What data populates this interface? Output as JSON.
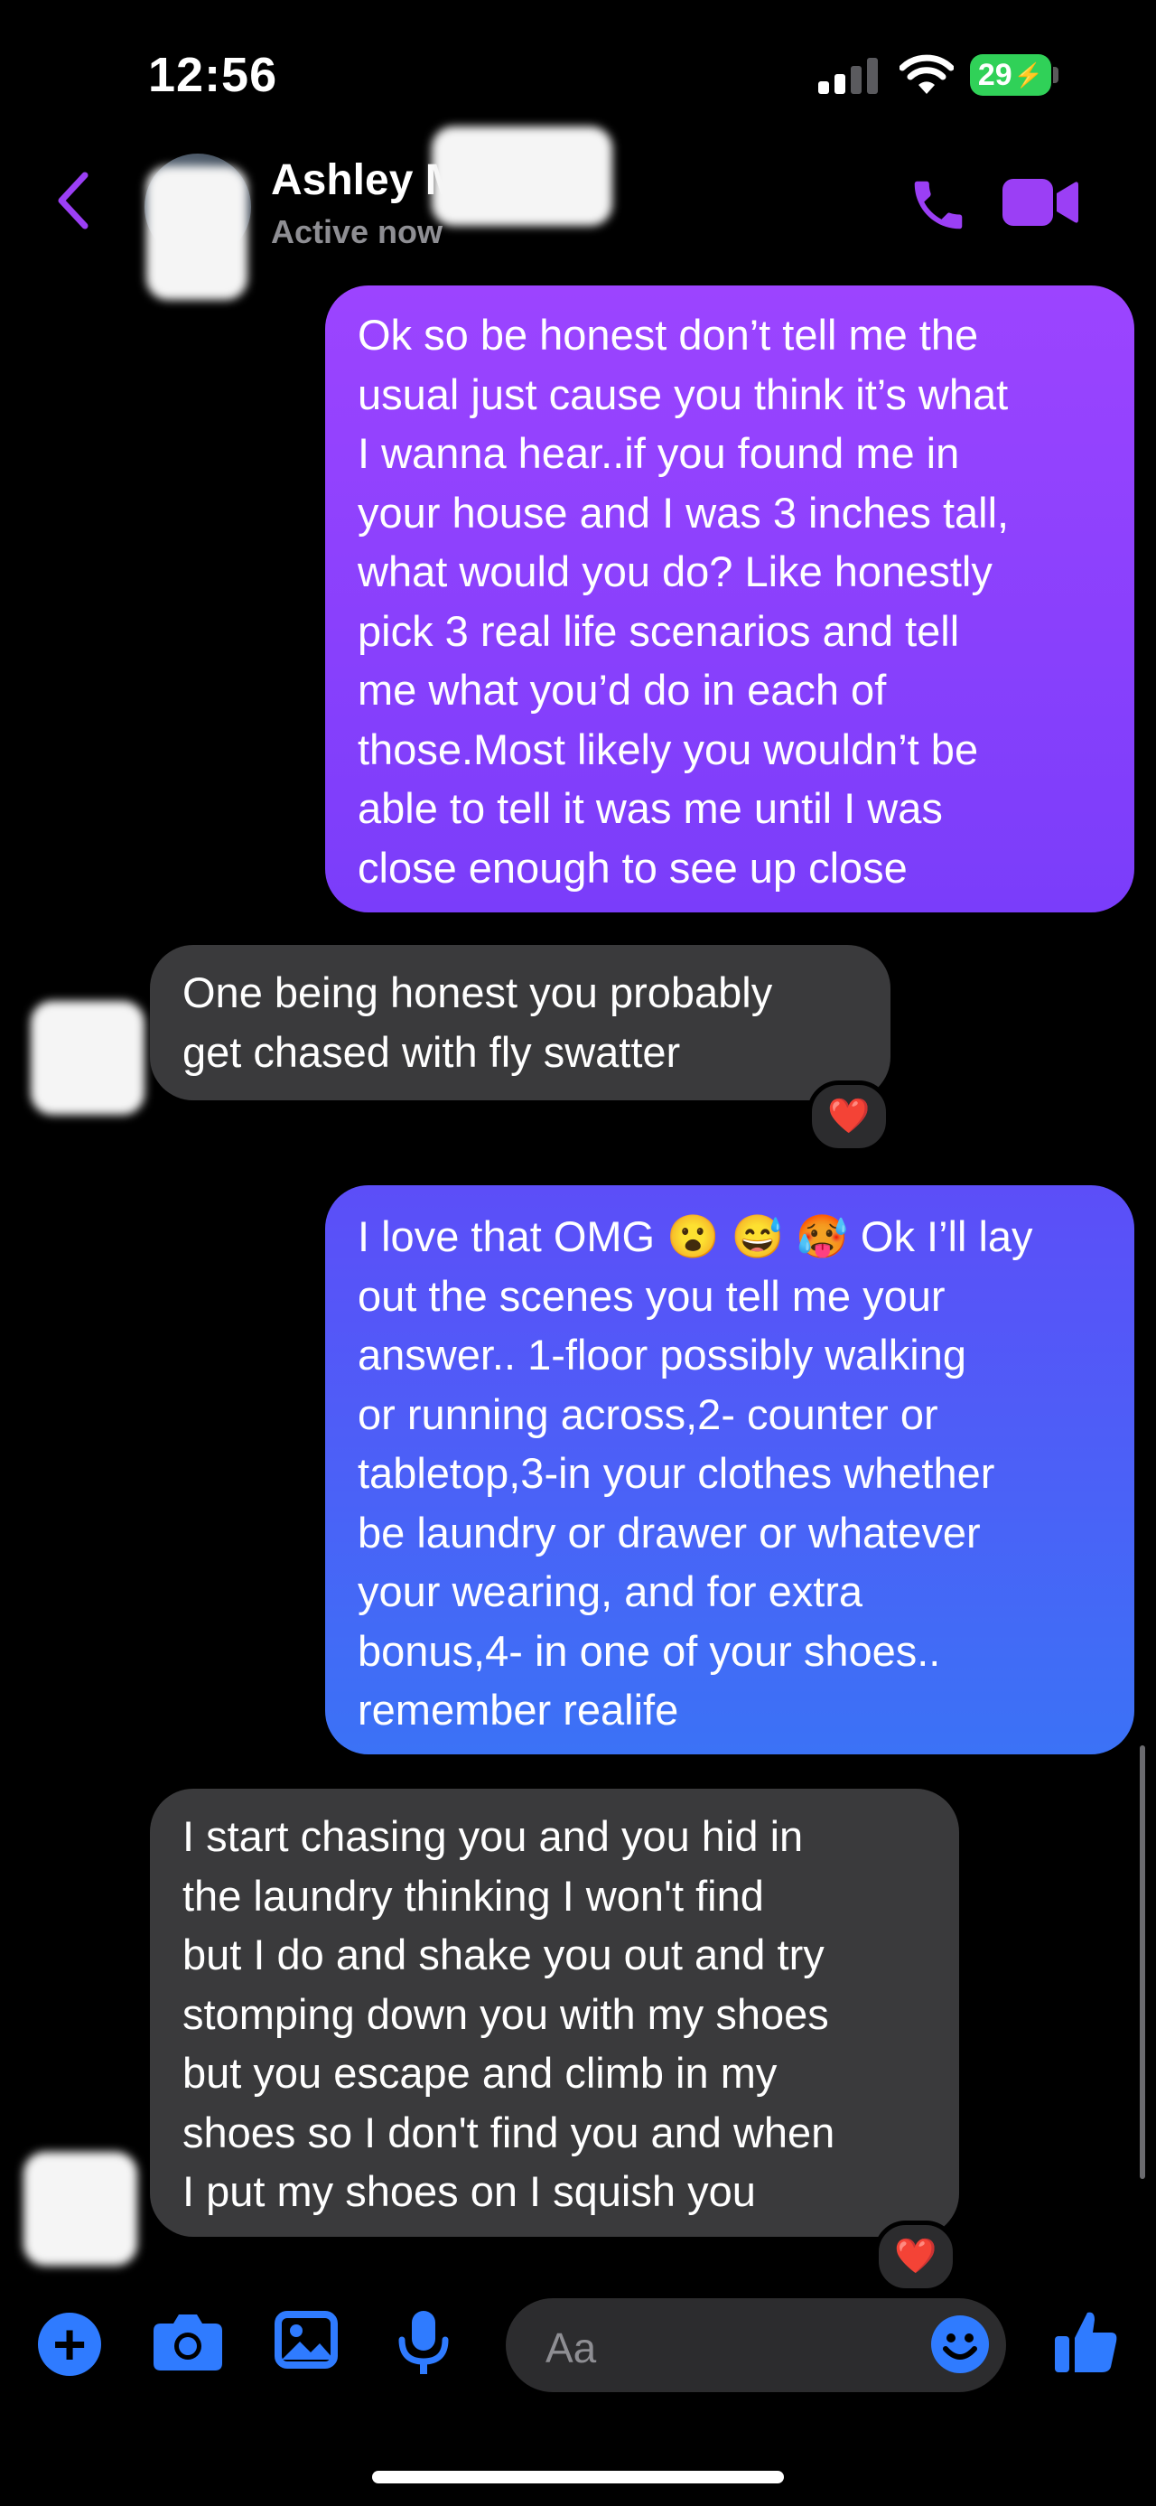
{
  "status_bar": {
    "time": "12:56",
    "battery": "29"
  },
  "header": {
    "name": "Ashley M",
    "status": "Active now"
  },
  "messages": [
    {
      "dir": "out",
      "text": "Ok so be honest don’t tell me the\nusual just cause you think it’s what\nI wanna hear..if you found me in\nyour house and I was 3 inches tall,\nwhat would you do? Like honestly\npick 3 real life scenarios and tell\nme what you’d do in each of\nthose.Most likely you wouldn’t be\nable to tell it was me until I was\nclose enough to see up close"
    },
    {
      "dir": "in",
      "text": "One being honest you probably\nget chased with fly swatter",
      "reaction": "❤️"
    },
    {
      "dir": "out",
      "text": "I love that OMG 😮 😅 🥵 Ok I’ll lay\nout the scenes you tell me your\nanswer.. 1-floor possibly walking\nor running across,2- counter or\ntabletop,3-in your clothes whether\nbe laundry or drawer or whatever\nyour wearing, and for extra\nbonus,4- in one of your shoes..\nremember realife"
    },
    {
      "dir": "in",
      "text": "I start chasing you and you hid in\nthe laundry thinking I won't find\nbut I do and shake you out and try\nstomping down you with my shoes\nbut you escape and climb in my\nshoes so I don't find you and when\nI put my shoes on I squish you",
      "reaction": "❤️"
    }
  ],
  "composer": {
    "placeholder": "Aa",
    "plus": "+"
  },
  "colors": {
    "accent": "#9b3ff5",
    "outgoing_top": "#9c44ff",
    "outgoing_bottom": "#3b72f6",
    "incoming": "#3a3a3c",
    "toolbar_blue": "#2f7bff"
  },
  "icons": [
    "back-chevron-icon",
    "phone-icon",
    "video-camera-icon",
    "plus-icon",
    "camera-icon",
    "photo-icon",
    "microphone-icon",
    "emoji-icon",
    "thumbs-up-icon",
    "heart-reaction-icon"
  ]
}
